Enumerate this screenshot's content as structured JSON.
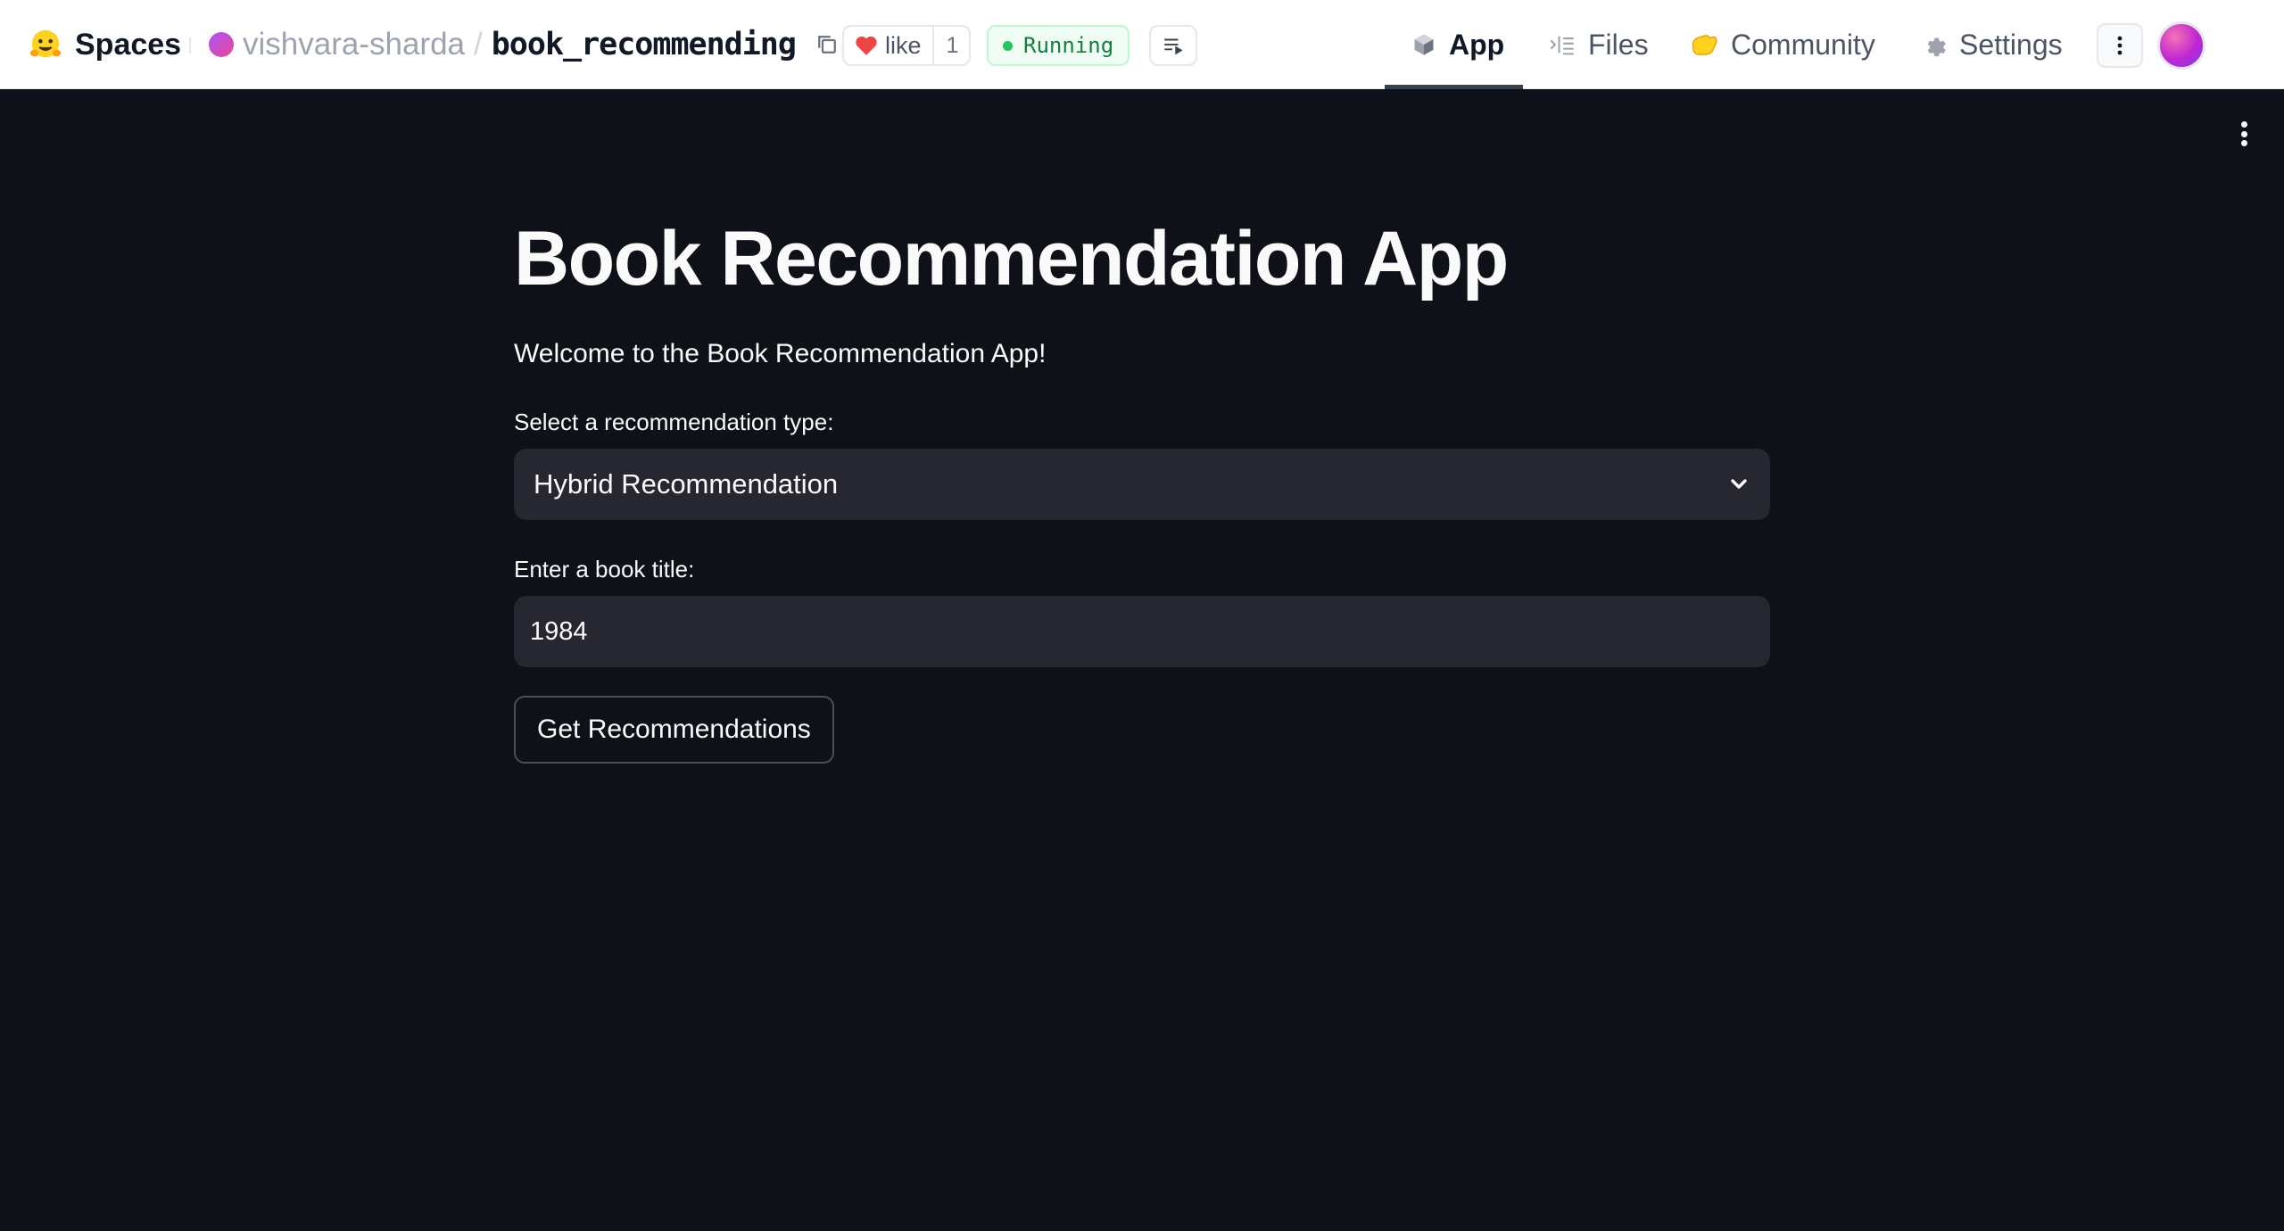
{
  "header": {
    "brand": "Spaces",
    "owner": "vishvara-sharda",
    "separator": "/",
    "repo_name": "book_recommending",
    "like_label": "like",
    "like_count": "1",
    "status": "Running",
    "status_color": "#22c55e",
    "tabs": [
      {
        "label": "App",
        "icon": "app-box-icon",
        "active": true
      },
      {
        "label": "Files",
        "icon": "files-icon",
        "active": false
      },
      {
        "label": "Community",
        "icon": "community-hands-icon",
        "active": false
      },
      {
        "label": "Settings",
        "icon": "gear-icon",
        "active": false
      }
    ]
  },
  "app": {
    "title": "Book Recommendation App",
    "welcome": "Welcome to the Book Recommendation App!",
    "select_label": "Select a recommendation type:",
    "select_value": "Hybrid Recommendation",
    "input_label": "Enter a book title:",
    "input_value": "1984",
    "button_label": "Get Recommendations",
    "background": "#0e1117",
    "widget_background": "#262730"
  }
}
